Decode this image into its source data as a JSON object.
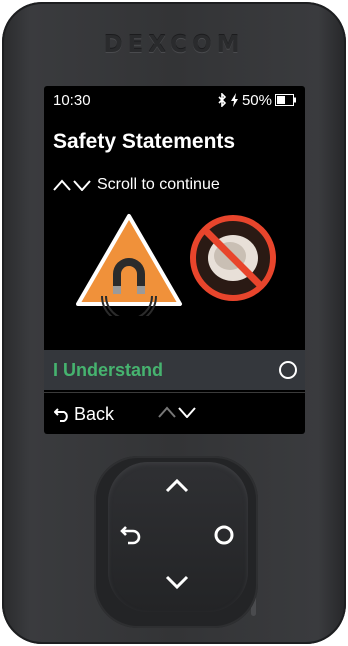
{
  "device": {
    "brand": "Dexcom"
  },
  "status_bar": {
    "time": "10:30",
    "battery": "50%"
  },
  "screen": {
    "title": "Safety Statements",
    "scroll_hint": "Scroll to continue",
    "warning_icons": [
      "magnet-warning-icon",
      "no-tablet-icon"
    ],
    "option_label": "I Understand",
    "back_label": "Back"
  },
  "colors": {
    "accent_green": "#46b36f",
    "warning_orange": "#f0913a",
    "prohibit_red": "#e8452c"
  },
  "dpad": {
    "up": "chevron-up-icon",
    "down": "chevron-down-icon",
    "left": "back-arrow-icon",
    "right": "select-circle-icon"
  }
}
